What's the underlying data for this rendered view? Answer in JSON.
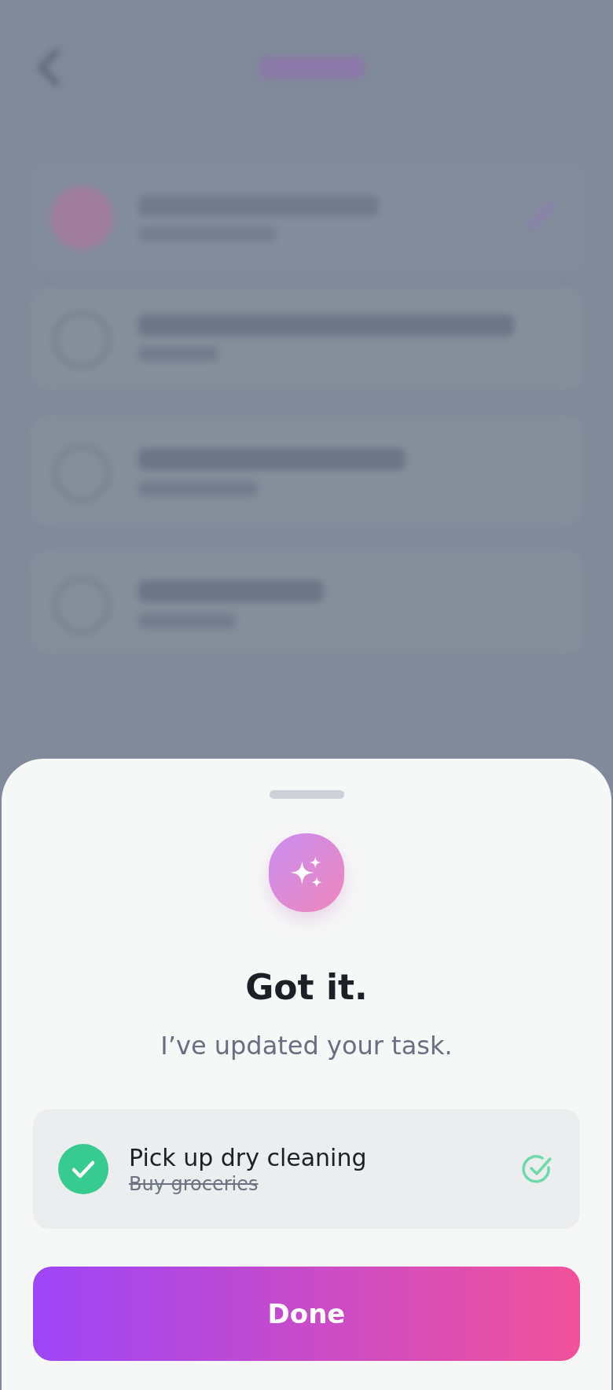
{
  "sheet": {
    "title": "Got it.",
    "message": "I’ve updated your task.",
    "change": {
      "new_title": "Pick up dry cleaning",
      "old_title": "Buy groceries",
      "checked": true
    },
    "button": "Done"
  }
}
